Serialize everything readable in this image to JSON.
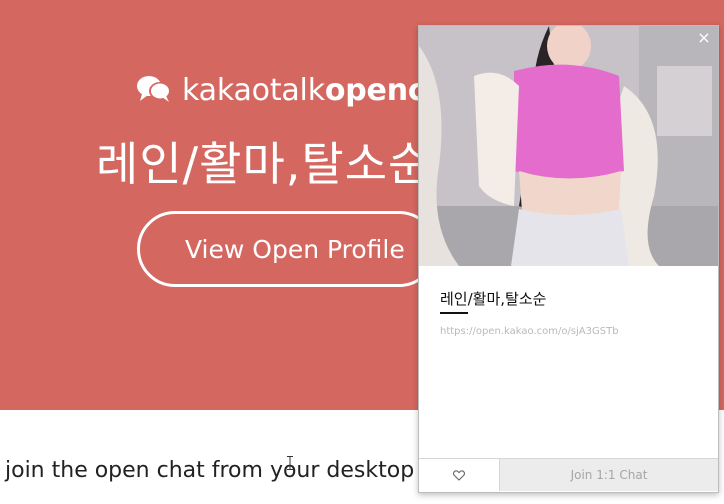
{
  "hero": {
    "brand_regular": "kakaotalk",
    "brand_bold": "openchat",
    "title": "레인/활마,탈소순",
    "profile_button": "View Open Profile",
    "background": "#d46860"
  },
  "page": {
    "bottom_text": "join the open chat from your desktop"
  },
  "popup": {
    "close": "×",
    "title": "레인/활마,탈소순",
    "url": "https://open.kakao.com/o/sjA3GSTb",
    "join_button": "Join 1:1 Chat",
    "like_icon": "heart-outline-icon"
  }
}
